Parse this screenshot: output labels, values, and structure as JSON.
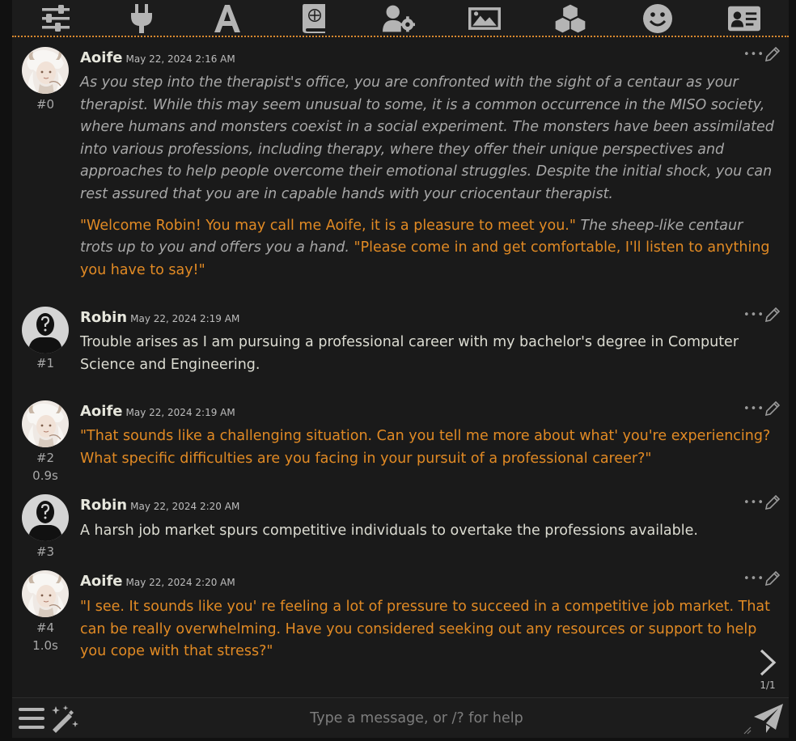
{
  "topbar": {
    "icons": [
      "sliders-icon",
      "plug-icon",
      "font-icon",
      "book-atlas-icon",
      "user-gear-icon",
      "image-icon",
      "cubes-icon",
      "smiley-icon",
      "address-card-icon"
    ]
  },
  "messages": [
    {
      "id": "#0",
      "name": "Aoife",
      "timestamp": "May 22, 2024 2:16 AM",
      "avatar": "character-avatar",
      "paragraphs": [
        [
          {
            "style": "narr",
            "text": "As you step into the therapist's office, you are confronted with the sight of a centaur as your therapist. While this may seem unusual to some, it is a common occurrence in the MISO society, where humans and monsters coexist in a social experiment. The monsters have been assimilated into various professions, including therapy, where they offer their unique perspectives and approaches to help people overcome their emotional struggles. Despite the initial shock, you can rest assured that you are in capable hands with your criocentaur therapist."
          }
        ],
        [
          {
            "style": "speech",
            "text": "\"Welcome Robin! You may call me Aoife, it is a pleasure to meet you.\""
          },
          {
            "style": "narr",
            "text": " The sheep-like centaur trots up to you and offers you a hand. "
          },
          {
            "style": "speech",
            "text": "\"Please come in and get comfortable, I'll listen to anything you have to say!\""
          }
        ]
      ]
    },
    {
      "id": "#1",
      "name": "Robin",
      "timestamp": "May 22, 2024 2:19 AM",
      "avatar": "user-avatar",
      "paragraphs": [
        [
          {
            "style": "plain",
            "text": "Trouble arises as I am pursuing a professional career with my bachelor's degree in Computer Science and Engineering."
          }
        ]
      ]
    },
    {
      "id": "#2",
      "time": "0.9s",
      "name": "Aoife",
      "timestamp": "May 22, 2024 2:19 AM",
      "avatar": "character-avatar",
      "paragraphs": [
        [
          {
            "style": "speech",
            "text": "\"That sounds like a challenging situation. Can you tell me more about what' you're experiencing? What specific difficulties are you facing in your pursuit of a professional career?\""
          }
        ]
      ]
    },
    {
      "id": "#3",
      "name": "Robin",
      "timestamp": "May 22, 2024 2:20 AM",
      "avatar": "user-avatar",
      "paragraphs": [
        [
          {
            "style": "plain",
            "text": "A harsh job market spurs competitive individuals to overtake the professions available."
          }
        ]
      ]
    },
    {
      "id": "#4",
      "time": "1.0s",
      "name": "Aoife",
      "timestamp": "May 22, 2024 2:20 AM",
      "avatar": "character-avatar",
      "paragraphs": [
        [
          {
            "style": "speech",
            "text": "\"I see. It sounds like you' re feeling a lot of pressure to succeed in a competitive job market. That can be really overwhelming. Have you considered seeking out any resources or support to help you cope with that stress?\""
          }
        ]
      ]
    }
  ],
  "swipe": {
    "counter": "1/1"
  },
  "composer": {
    "placeholder": "Type a message, or /? for help"
  },
  "colors": {
    "accent": "#e18a24",
    "narration": "#a8a8a8",
    "text": "#dcdcd2",
    "background": "#1a1a1a"
  }
}
